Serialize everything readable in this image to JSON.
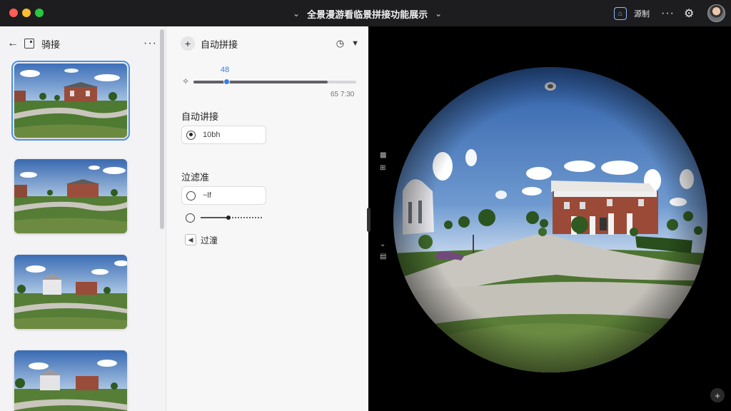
{
  "titlebar": {
    "title": "全景漫游看临景拼接功能展示",
    "share_label": "源制"
  },
  "left_panel": {
    "title": "骑接",
    "thumbnails": [
      {
        "label": "pano-1",
        "selected": true
      },
      {
        "label": "pano-2",
        "selected": false
      },
      {
        "label": "pano-3",
        "selected": false
      },
      {
        "label": "pano-4",
        "selected": false
      }
    ]
  },
  "mid_panel": {
    "header_title": "自动拼接",
    "slider": {
      "value_label": "48",
      "range_label": "65 7:30",
      "value_fraction": 0.2
    },
    "section1": {
      "title": "自动讲接",
      "option": "10bh"
    },
    "section2": {
      "title": "泣滤准",
      "option": "~lf",
      "slider_fraction": 0.45
    },
    "filter_label": "过潼"
  },
  "colors": {
    "accent": "#3b7ddd",
    "titlebar_bg": "#1d1d1f",
    "panel_bg": "#f3f3f5"
  }
}
